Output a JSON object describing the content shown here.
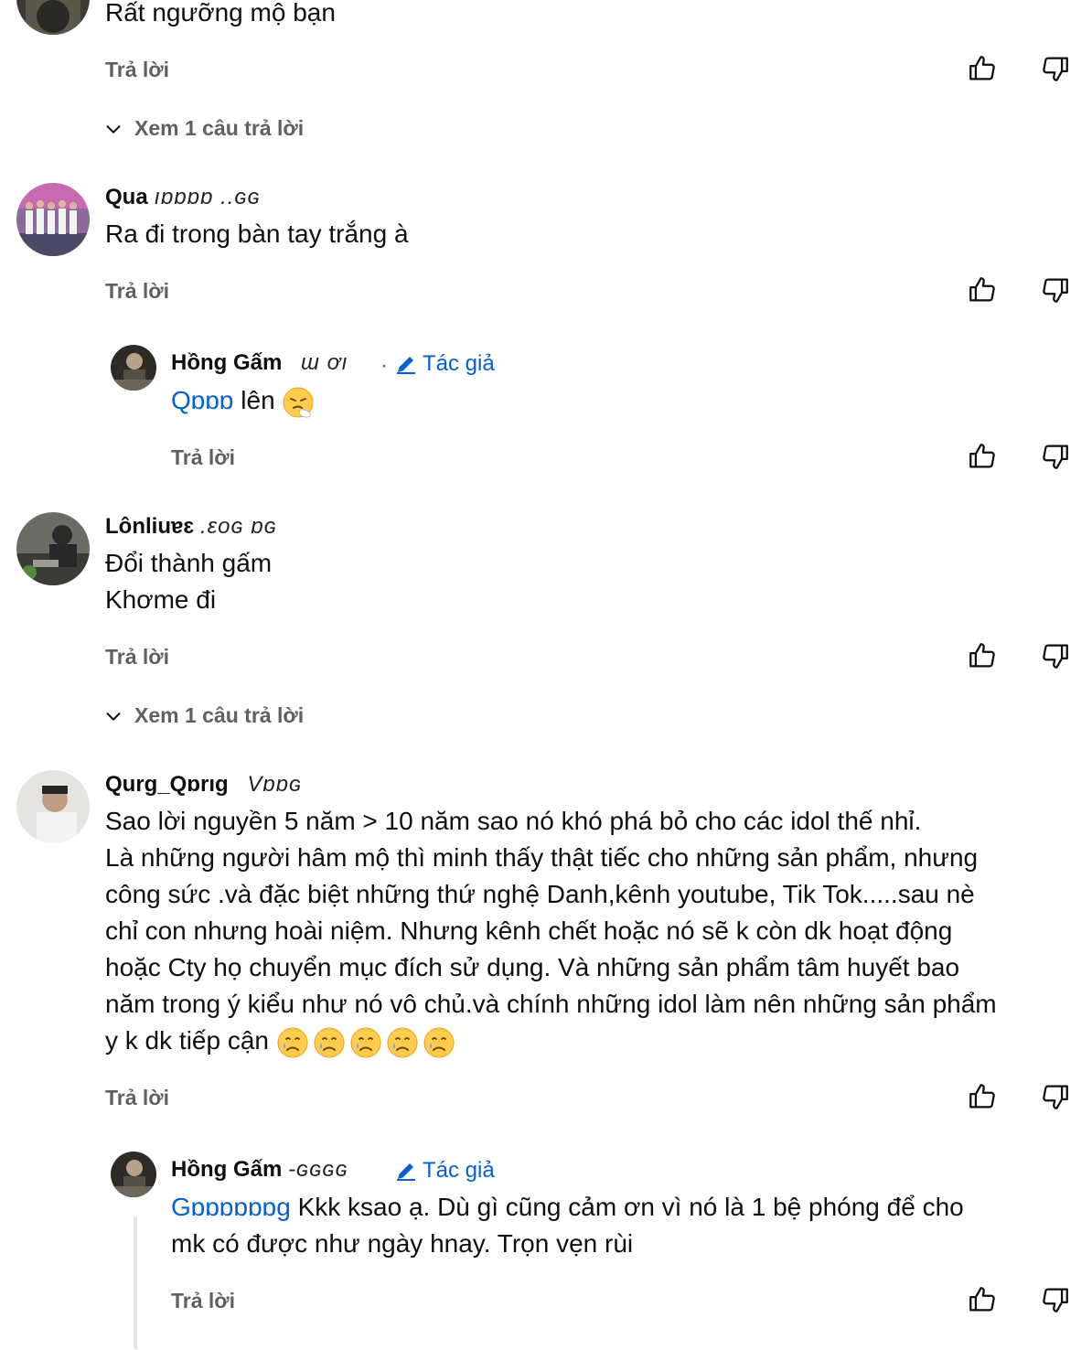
{
  "c0": {
    "text": "Rất ngưỡng mộ bạn",
    "reply": "Trả lời",
    "view_replies": "Xem 1 câu trả lời"
  },
  "c1": {
    "author": "Qua",
    "author_obscured": "ıɒɒɒɒ ..ɢɢ",
    "text": "Ra đi trong bàn tay trắng à",
    "reply": "Trả lời"
  },
  "r1": {
    "author": "Hồng Gấm",
    "time": "ɯ ơı",
    "dot": "·",
    "author_badge": "Tác giả",
    "mention": "Qɒɒɒ",
    "text": "lên",
    "reply": "Trả lời"
  },
  "c2": {
    "author": "Lônliuɐɛ",
    "author_obscured": ".ɛoɢ ɒɢ",
    "line1": "Đổi thành gấm",
    "line2": "Khơme đi",
    "reply": "Trả lời",
    "view_replies": "Xem 1 câu trả lời"
  },
  "c3": {
    "author": "Qurɡ_Qɒrıɡ",
    "author_obscured": "Vɒɒɢ",
    "text": "Sao lời nguyền 5 năm > 10 năm  sao nó khó phá bỏ cho các idol thế nhỉ.",
    "line2": "Là những người hâm mộ thì minh thấy thật tiếc cho những sản phẩm, nhưng",
    "line3": "công sức .và đặc biệt những thứ  nghệ Danh,kênh  youtube, Tik Tok.....sau nè",
    "line4": "chỉ con nhưng hoài niệm. Nhưng kênh chết hoặc nó sẽ k còn dk hoạt động",
    "line5": "hoặc Cty họ chuyển mục đích sử dụng. Và những sản phẩm tâm huyết bao",
    "line6": "năm trong ý kiểu như nó vô chủ.và chính những idol làm nên những sản phẩm",
    "line7": "y k dk tiếp cận",
    "reply": "Trả lời"
  },
  "r3": {
    "author": "Hồng Gấm",
    "time": "-ɢɢɢɢ",
    "author_badge": "Tác giả",
    "mention": "Gɒɒɒɒɒɒɡ",
    "line1": "Kkk ksao ạ. Dù gì cũng cảm ơn vì nó là 1 bệ phóng để cho",
    "line2": "mk có được như ngày hnay. Trọn vẹn rùi",
    "reply": "Trả lời"
  },
  "colors": {
    "text": "#0f0f0f",
    "secondary": "#606060",
    "link": "#065fd4"
  },
  "icons": [
    "like-icon",
    "dislike-icon",
    "chevron-down-icon",
    "pencil-icon",
    "sad-face-emoji"
  ]
}
